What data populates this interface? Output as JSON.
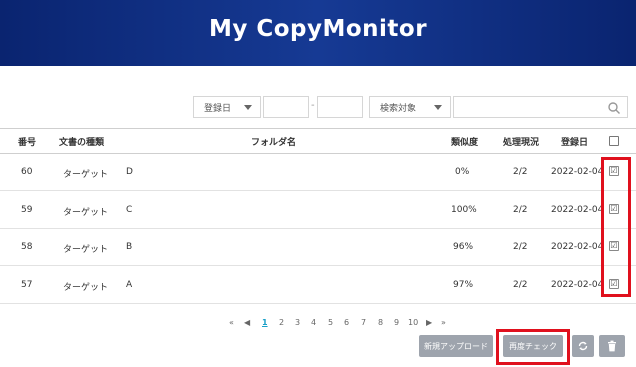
{
  "header": {
    "title": "My CopyMonitor"
  },
  "filters": {
    "date_select": "登録日",
    "date_from": "",
    "date_to": "",
    "date_separator": "-",
    "search_target_select": "検索対象",
    "search_value": ""
  },
  "table": {
    "columns": {
      "number": "番号",
      "doc_type": "文書の種類",
      "folder": "フォルダ名",
      "similarity": "類似度",
      "status": "処理現況",
      "date": "登録日"
    },
    "rows": [
      {
        "number": "60",
        "doc_type": "ターゲット",
        "folder": "D",
        "similarity": "0%",
        "status": "2/2",
        "date": "2022-02-04",
        "checked": "☑"
      },
      {
        "number": "59",
        "doc_type": "ターゲット",
        "folder": "C",
        "similarity": "100%",
        "status": "2/2",
        "date": "2022-02-04",
        "checked": "☑"
      },
      {
        "number": "58",
        "doc_type": "ターゲット",
        "folder": "B",
        "similarity": "96%",
        "status": "2/2",
        "date": "2022-02-04",
        "checked": "☑"
      },
      {
        "number": "57",
        "doc_type": "ターゲット",
        "folder": "A",
        "similarity": "97%",
        "status": "2/2",
        "date": "2022-02-04",
        "checked": "☑"
      }
    ]
  },
  "pagination": {
    "first": "«",
    "prev": "◀",
    "pages": [
      "1",
      "2",
      "3",
      "4",
      "5",
      "6",
      "7",
      "8",
      "9",
      "10"
    ],
    "current": "1",
    "next": "▶",
    "last": "»"
  },
  "actions": {
    "new_upload": "新規アップロード",
    "recheck": "再度チェック"
  },
  "icons": {
    "search": "search-icon",
    "refresh": "refresh-icon",
    "trash": "trash-icon"
  },
  "colors": {
    "header_bg": "#0a2470",
    "highlight": "#e0101d",
    "button_bg": "#9ea4ad",
    "active_page": "#1aa0c8"
  }
}
